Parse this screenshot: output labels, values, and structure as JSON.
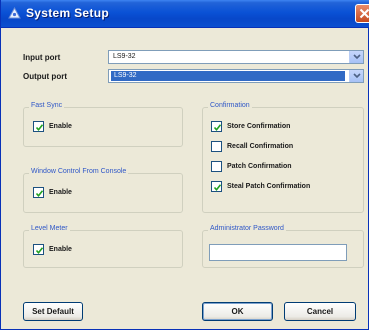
{
  "window": {
    "title": "System Setup"
  },
  "ports": {
    "input_label": "Input port",
    "input_value": "LS9-32",
    "output_label": "Output port",
    "output_value": "LS9-32"
  },
  "fast_sync": {
    "title": "Fast Sync",
    "enable_label": "Enable",
    "enabled": true
  },
  "window_control": {
    "title": "Window Control From Console",
    "enable_label": "Enable",
    "enabled": true
  },
  "level_meter": {
    "title": "Level Meter",
    "enable_label": "Enable",
    "enabled": true
  },
  "confirmation": {
    "title": "Confirmation",
    "items": [
      {
        "label": "Store Confirmation",
        "checked": true
      },
      {
        "label": "Recall Confirmation",
        "checked": false
      },
      {
        "label": "Patch Confirmation",
        "checked": false
      },
      {
        "label": "Steal Patch Confirmation",
        "checked": true
      }
    ]
  },
  "admin_password": {
    "title": "Administrator Password",
    "value": ""
  },
  "buttons": {
    "set_default": "Set Default",
    "ok": "OK",
    "cancel": "Cancel"
  },
  "colors": {
    "titlebar": "#0a52d6",
    "group_title": "#2f57c7",
    "selection": "#316ac5",
    "window_bg": "#ece9d8"
  }
}
